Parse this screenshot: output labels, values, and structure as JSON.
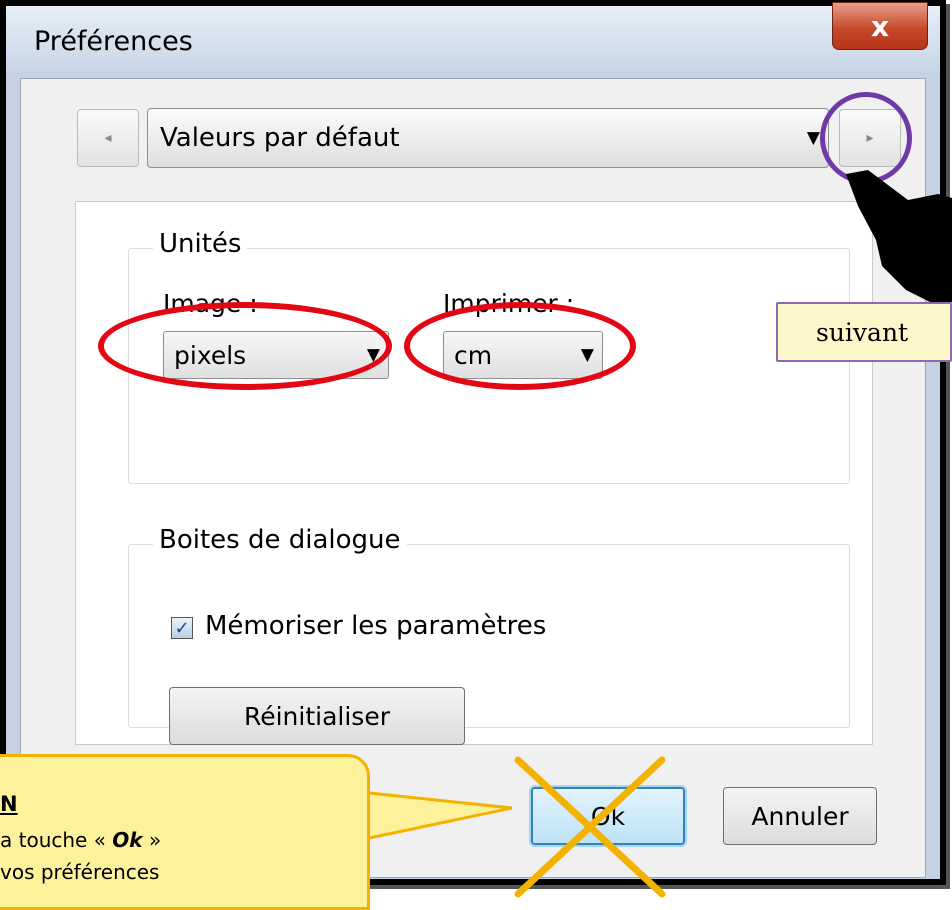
{
  "window": {
    "title": "Préférences",
    "close_label": "x"
  },
  "navigation": {
    "prev_arrow": "◂",
    "next_arrow": "▸",
    "page_select_value": "Valeurs par défaut",
    "dropdown_caret": "▼"
  },
  "units_group": {
    "label": "Unités",
    "image_label": "Image :",
    "image_value": "pixels",
    "print_label": "Imprimer :",
    "print_value": "cm"
  },
  "dialog_group": {
    "label": "Boites de dialogue",
    "remember_checked": true,
    "check_glyph": "✓",
    "remember_label": "Mémoriser les paramètres",
    "reset_button": "Réinitialiser"
  },
  "footer": {
    "ok_button": "Ok",
    "cancel_button": "Annuler"
  },
  "annotations": {
    "next_callout": "suivant",
    "note_title": "N",
    "note_line1_prefix": "a touche « ",
    "note_line1_key": "Ok",
    "note_line1_suffix": " »",
    "note_line2": " vos préférences",
    "highlight_color": "#e30613",
    "purple_color": "#6f3aa8",
    "note_fill": "#fdf29b",
    "note_border": "#f4b200"
  }
}
